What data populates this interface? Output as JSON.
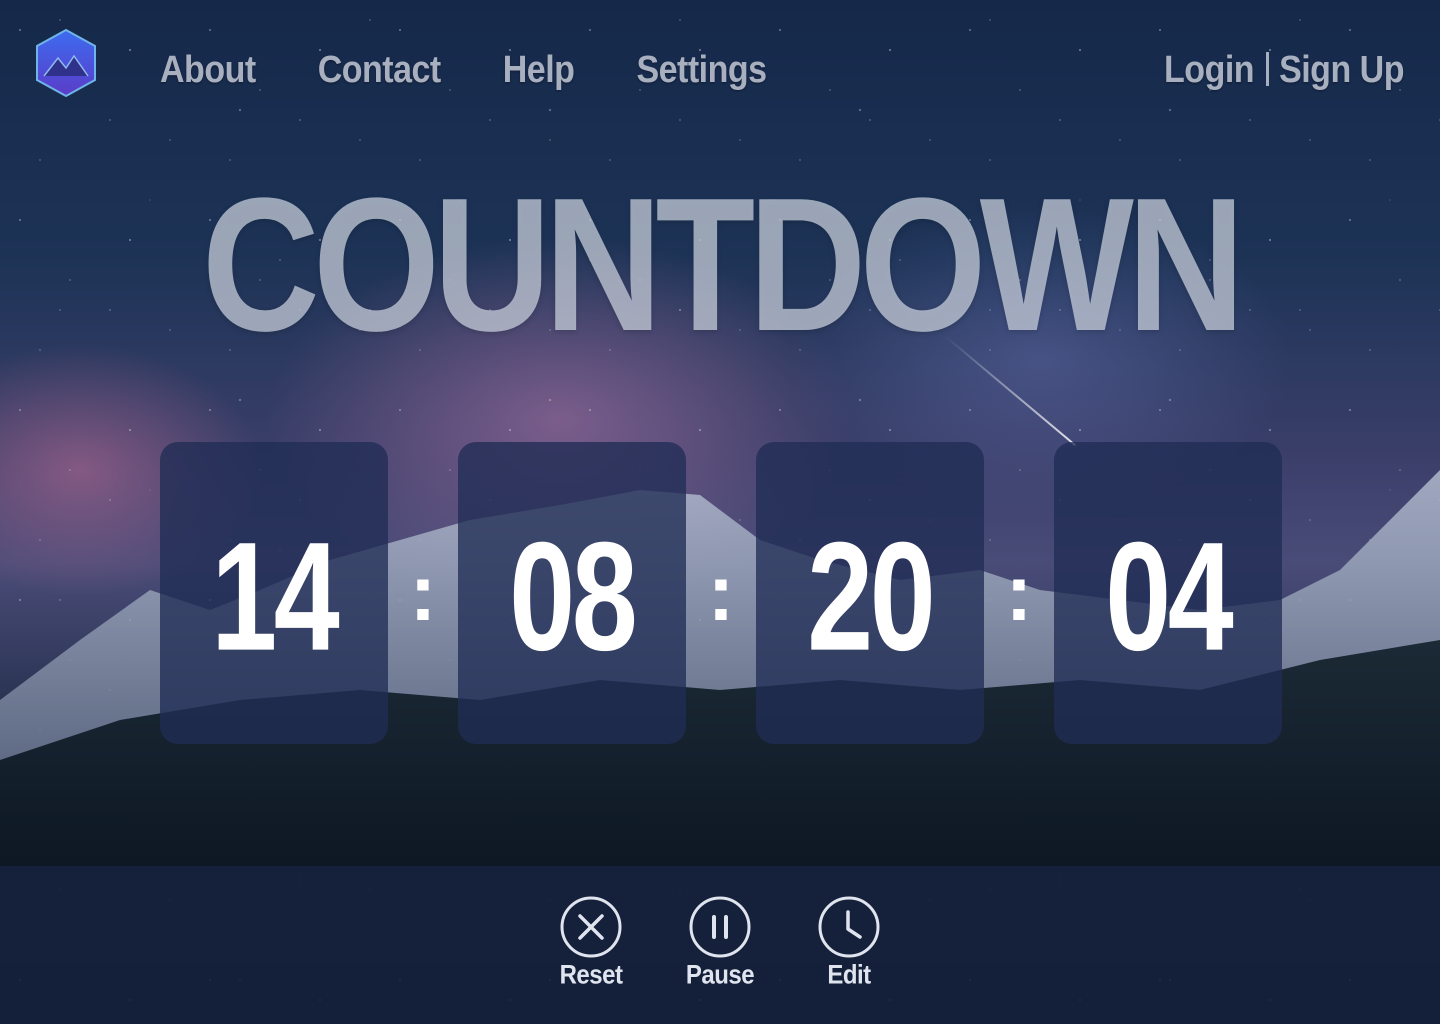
{
  "nav": {
    "links": [
      "About",
      "Contact",
      "Help",
      "Settings"
    ],
    "login": "Login",
    "signup": "Sign Up"
  },
  "title": "COUNTDOWN",
  "timer": {
    "units": [
      "14",
      "08",
      "20",
      "04"
    ],
    "separator": ":"
  },
  "controls": {
    "reset": {
      "label": "Reset",
      "icon": "close-circle-icon"
    },
    "pause": {
      "label": "Pause",
      "icon": "pause-circle-icon"
    },
    "edit": {
      "label": "Edit",
      "icon": "clock-icon"
    }
  },
  "colors": {
    "nav_text": "#a8afbf",
    "digit_box": "#202d54",
    "accent": "#3b5bd6"
  }
}
